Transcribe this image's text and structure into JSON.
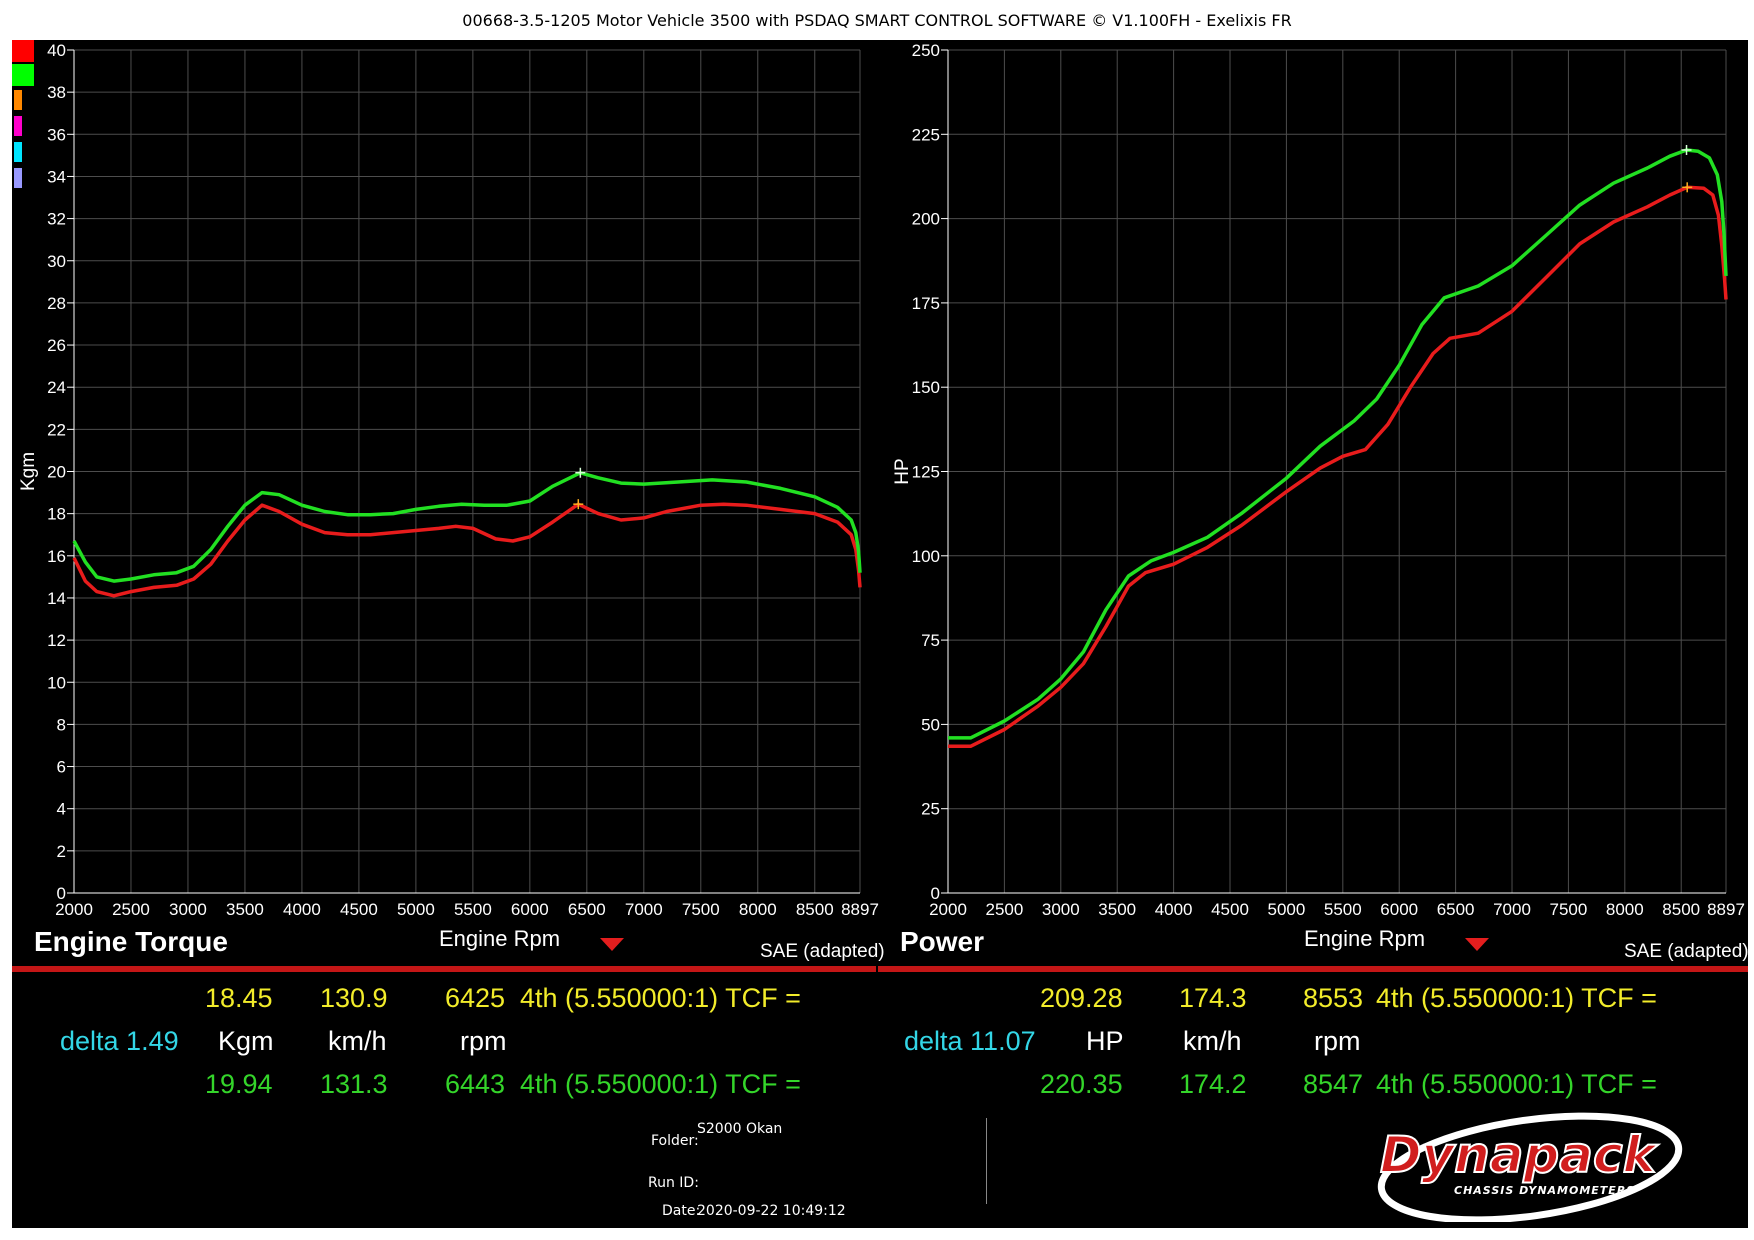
{
  "title": "00668-3.5-1205 Motor Vehicle 3500 with PSDAQ SMART CONTROL SOFTWARE © V1.100FH - Exelixis FR",
  "colors": {
    "background": "#000000",
    "grid": "#4d4d4d",
    "run_red": "#e81c1c",
    "run_green": "#22e022",
    "text_yellow": "#f2ec2a",
    "text_green": "#34d52a",
    "text_cyan": "#33d6e6",
    "swatches": [
      "#ff0000",
      "#00ff00",
      "#ff8800",
      "#ff00cc",
      "#00e5ff",
      "#9999ff"
    ]
  },
  "chart_data": [
    {
      "type": "line",
      "title": "Engine Torque",
      "xlabel": "Engine Rpm",
      "ylabel": "Kgm",
      "note": "SAE (adapted)",
      "xlim": [
        2000,
        8897
      ],
      "ylim": [
        0,
        40
      ],
      "x_ticks": [
        "2000",
        "2500",
        "3000",
        "3500",
        "4000",
        "4500",
        "5000",
        "5500",
        "6000",
        "6500",
        "7000",
        "7500",
        "8000",
        "8500",
        "8897"
      ],
      "y_ticks": [
        "0",
        "2",
        "4",
        "6",
        "8",
        "10",
        "12",
        "14",
        "16",
        "18",
        "20",
        "22",
        "24",
        "26",
        "28",
        "30",
        "32",
        "34",
        "36",
        "38",
        "40"
      ],
      "grid": true,
      "series": [
        {
          "color": "red",
          "marker": {
            "x": 6425,
            "y": 18.45
          },
          "points": [
            [
              2000,
              15.9
            ],
            [
              2100,
              14.8
            ],
            [
              2200,
              14.3
            ],
            [
              2350,
              14.1
            ],
            [
              2500,
              14.3
            ],
            [
              2700,
              14.5
            ],
            [
              2900,
              14.6
            ],
            [
              3050,
              14.9
            ],
            [
              3200,
              15.6
            ],
            [
              3350,
              16.7
            ],
            [
              3500,
              17.7
            ],
            [
              3650,
              18.4
            ],
            [
              3800,
              18.1
            ],
            [
              4000,
              17.5
            ],
            [
              4200,
              17.1
            ],
            [
              4400,
              17.0
            ],
            [
              4600,
              17.0
            ],
            [
              4800,
              17.1
            ],
            [
              5000,
              17.2
            ],
            [
              5200,
              17.3
            ],
            [
              5350,
              17.4
            ],
            [
              5500,
              17.3
            ],
            [
              5700,
              16.8
            ],
            [
              5850,
              16.7
            ],
            [
              6000,
              16.9
            ],
            [
              6200,
              17.6
            ],
            [
              6425,
              18.45
            ],
            [
              6600,
              18.0
            ],
            [
              6800,
              17.7
            ],
            [
              7000,
              17.8
            ],
            [
              7200,
              18.1
            ],
            [
              7500,
              18.4
            ],
            [
              7700,
              18.45
            ],
            [
              7900,
              18.4
            ],
            [
              8200,
              18.2
            ],
            [
              8500,
              18.0
            ],
            [
              8700,
              17.6
            ],
            [
              8820,
              17.0
            ],
            [
              8860,
              16.3
            ],
            [
              8885,
              15.3
            ],
            [
              8897,
              14.5
            ]
          ]
        },
        {
          "color": "green",
          "marker": {
            "x": 6443,
            "y": 19.94
          },
          "points": [
            [
              2000,
              16.7
            ],
            [
              2100,
              15.7
            ],
            [
              2200,
              15.0
            ],
            [
              2350,
              14.8
            ],
            [
              2500,
              14.9
            ],
            [
              2700,
              15.1
            ],
            [
              2900,
              15.2
            ],
            [
              3050,
              15.5
            ],
            [
              3200,
              16.3
            ],
            [
              3350,
              17.4
            ],
            [
              3500,
              18.4
            ],
            [
              3650,
              19.0
            ],
            [
              3800,
              18.9
            ],
            [
              4000,
              18.4
            ],
            [
              4200,
              18.1
            ],
            [
              4400,
              17.95
            ],
            [
              4600,
              17.95
            ],
            [
              4800,
              18.0
            ],
            [
              5000,
              18.2
            ],
            [
              5200,
              18.35
            ],
            [
              5400,
              18.45
            ],
            [
              5600,
              18.4
            ],
            [
              5800,
              18.4
            ],
            [
              6000,
              18.6
            ],
            [
              6200,
              19.3
            ],
            [
              6443,
              19.94
            ],
            [
              6600,
              19.7
            ],
            [
              6800,
              19.45
            ],
            [
              7000,
              19.4
            ],
            [
              7300,
              19.5
            ],
            [
              7600,
              19.6
            ],
            [
              7900,
              19.5
            ],
            [
              8200,
              19.2
            ],
            [
              8500,
              18.8
            ],
            [
              8700,
              18.3
            ],
            [
              8820,
              17.7
            ],
            [
              8860,
              17.1
            ],
            [
              8885,
              16.2
            ],
            [
              8897,
              15.2
            ]
          ]
        }
      ]
    },
    {
      "type": "line",
      "title": "Power",
      "xlabel": "Engine Rpm",
      "ylabel": "HP",
      "note": "SAE (adapted)",
      "xlim": [
        2000,
        8897
      ],
      "ylim": [
        0,
        250
      ],
      "x_ticks": [
        "2000",
        "2500",
        "3000",
        "3500",
        "4000",
        "4500",
        "5000",
        "5500",
        "6000",
        "6500",
        "7000",
        "7500",
        "8000",
        "8500",
        "8897"
      ],
      "y_ticks": [
        "0",
        "25",
        "50",
        "75",
        "100",
        "125",
        "150",
        "175",
        "200",
        "225",
        "250"
      ],
      "grid": true,
      "series": [
        {
          "color": "red",
          "marker": {
            "x": 8553,
            "y": 209.28
          },
          "points": [
            [
              2000,
              43.5
            ],
            [
              2200,
              43.5
            ],
            [
              2500,
              48.5
            ],
            [
              2800,
              55.5
            ],
            [
              3000,
              61
            ],
            [
              3200,
              68
            ],
            [
              3400,
              79
            ],
            [
              3600,
              91
            ],
            [
              3750,
              95
            ],
            [
              4000,
              97.5
            ],
            [
              4300,
              102.5
            ],
            [
              4600,
              109
            ],
            [
              5000,
              119
            ],
            [
              5300,
              126
            ],
            [
              5500,
              129.5
            ],
            [
              5700,
              131.5
            ],
            [
              5900,
              139
            ],
            [
              6100,
              150
            ],
            [
              6300,
              160
            ],
            [
              6450,
              164.5
            ],
            [
              6700,
              166
            ],
            [
              7000,
              172.5
            ],
            [
              7300,
              182.5
            ],
            [
              7600,
              192.5
            ],
            [
              7900,
              199
            ],
            [
              8200,
              203.5
            ],
            [
              8400,
              207
            ],
            [
              8553,
              209.28
            ],
            [
              8700,
              209
            ],
            [
              8780,
              207
            ],
            [
              8830,
              201
            ],
            [
              8860,
              192
            ],
            [
              8885,
              182
            ],
            [
              8897,
              176
            ]
          ]
        },
        {
          "color": "green",
          "marker": {
            "x": 8547,
            "y": 220.35
          },
          "points": [
            [
              2000,
              46
            ],
            [
              2200,
              46
            ],
            [
              2500,
              51
            ],
            [
              2800,
              57.5
            ],
            [
              3000,
              63.5
            ],
            [
              3200,
              71.5
            ],
            [
              3400,
              84
            ],
            [
              3600,
              94
            ],
            [
              3800,
              98.5
            ],
            [
              4000,
              101
            ],
            [
              4300,
              105.5
            ],
            [
              4600,
              112.5
            ],
            [
              5000,
              123
            ],
            [
              5300,
              132.5
            ],
            [
              5600,
              140
            ],
            [
              5800,
              146.5
            ],
            [
              6000,
              156.5
            ],
            [
              6200,
              168.5
            ],
            [
              6400,
              176.5
            ],
            [
              6700,
              180
            ],
            [
              7000,
              186
            ],
            [
              7300,
              195
            ],
            [
              7600,
              204
            ],
            [
              7900,
              210.5
            ],
            [
              8200,
              215
            ],
            [
              8400,
              218.5
            ],
            [
              8547,
              220.35
            ],
            [
              8650,
              220
            ],
            [
              8750,
              218
            ],
            [
              8820,
              213
            ],
            [
              8860,
              205
            ],
            [
              8880,
              195
            ],
            [
              8897,
              183
            ]
          ]
        }
      ]
    }
  ],
  "torque_panel": {
    "title": "Engine Torque",
    "xlabel": "Engine Rpm",
    "note": "SAE (adapted)",
    "row1": {
      "value": "18.45",
      "speed": "130.9",
      "rpm": "6425",
      "gear": "4th (5.550000:1) TCF = "
    },
    "row2": {
      "delta": "delta 1.49",
      "unit": "Kgm",
      "speed_unit": "km/h",
      "rpm_unit": "rpm"
    },
    "row3": {
      "value": "19.94",
      "speed": "131.3",
      "rpm": "6443",
      "gear": "4th (5.550000:1) TCF = "
    }
  },
  "power_panel": {
    "title": "Power",
    "xlabel": "Engine Rpm",
    "note": "SAE (adapted)",
    "row1": {
      "value": "209.28",
      "speed": "174.3",
      "rpm": "8553",
      "gear": "4th (5.550000:1) TCF = "
    },
    "row2": {
      "delta": "delta 11.07",
      "unit": "HP",
      "speed_unit": "km/h",
      "rpm_unit": "rpm"
    },
    "row3": {
      "value": "220.35",
      "speed": "174.2",
      "rpm": "8547",
      "gear": "4th (5.550000:1) TCF = "
    }
  },
  "footer": {
    "folder_label": "Folder:",
    "folder_value": "S2000 Okan",
    "run_label": "Run ID:",
    "run_value": "",
    "date_label": "Date:",
    "date_value": "2020-09-22 10:49:12"
  },
  "logo": {
    "brand": "Dynapack",
    "tagline": "CHASSIS DYNAMOMETERS"
  }
}
